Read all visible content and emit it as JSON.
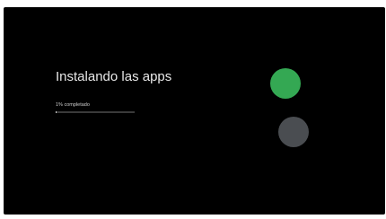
{
  "screen": {
    "title": "Instalando las apps",
    "progress_label": "1% completado",
    "progress_fraction": 0.01
  },
  "colors": {
    "background": "#000000",
    "accent_green": "#34a853",
    "inactive_gray": "#4a4d51"
  },
  "icons": {
    "primary_dot": "green-circle",
    "secondary_dot": "gray-circle"
  }
}
